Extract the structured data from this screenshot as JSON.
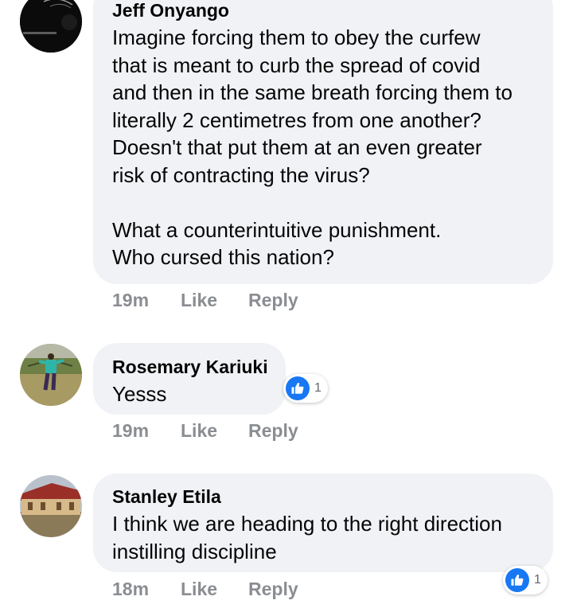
{
  "comments": [
    {
      "author": "Jeff Onyango",
      "text": "Imagine forcing them to obey the curfew\nthat is meant to curb the spread of covid\nand then in the same breath forcing them to\nliterally 2 centimetres from one another?\nDoesn't that put them at an even greater\nrisk of contracting the virus?\n\nWhat a counterintuitive punishment.\nWho cursed this nation?",
      "time": "19m",
      "like_label": "Like",
      "reply_label": "Reply"
    },
    {
      "author": "Rosemary Kariuki",
      "text": "Yesss",
      "time": "19m",
      "like_label": "Like",
      "reply_label": "Reply",
      "reaction_count": "1",
      "reaction_icon": "like-thumb-icon"
    },
    {
      "author": "Stanley Etila",
      "text": "I think we are heading to the right direction\ninstilling discipline",
      "time": "18m",
      "like_label": "Like",
      "reply_label": "Reply",
      "reaction_count": "1",
      "reaction_icon": "like-thumb-icon"
    }
  ],
  "colors": {
    "bubble": "#f0f2f5",
    "meta_text": "#8a8d91",
    "like_blue": "#1877f2"
  }
}
